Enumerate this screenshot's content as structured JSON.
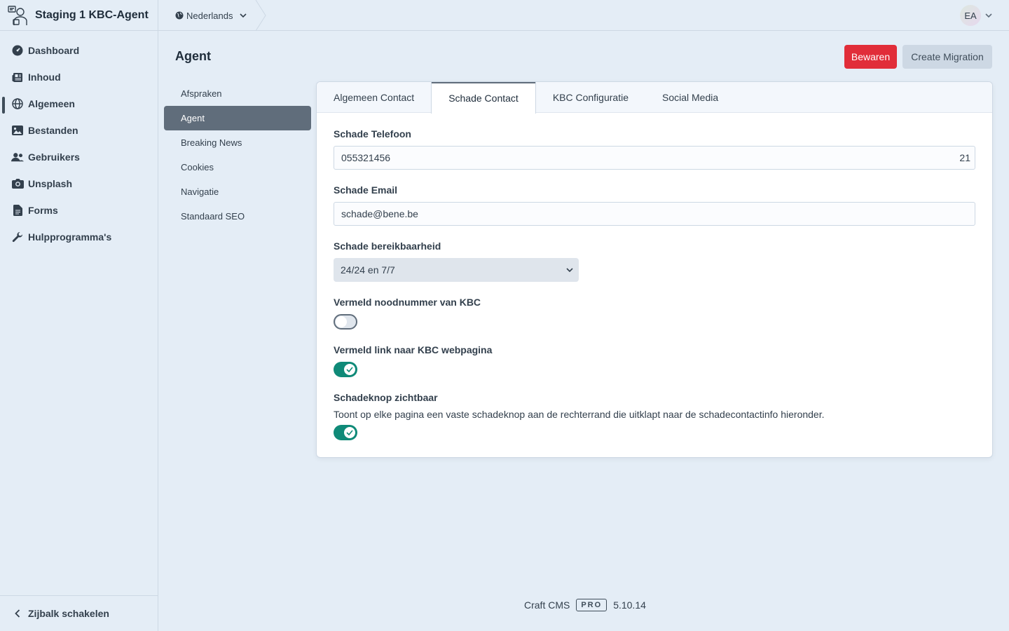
{
  "site": {
    "name": "Staging 1 KBC-Agent"
  },
  "nav": [
    {
      "label": "Dashboard",
      "icon": "gauge-icon"
    },
    {
      "label": "Inhoud",
      "icon": "newspaper-icon"
    },
    {
      "label": "Algemeen",
      "icon": "globe-icon",
      "active": true
    },
    {
      "label": "Bestanden",
      "icon": "image-icon"
    },
    {
      "label": "Gebruikers",
      "icon": "users-icon"
    },
    {
      "label": "Unsplash",
      "icon": "camera-icon"
    },
    {
      "label": "Forms",
      "icon": "file-icon"
    },
    {
      "label": "Hulpprogramma's",
      "icon": "wrench-icon"
    }
  ],
  "sidebar_toggle": "Zijbalk schakelen",
  "topbar": {
    "language": "Nederlands",
    "avatar_initials": "EA"
  },
  "page": {
    "title": "Agent",
    "save_label": "Bewaren",
    "migration_label": "Create Migration"
  },
  "subnav": [
    {
      "label": "Afspraken"
    },
    {
      "label": "Agent",
      "active": true
    },
    {
      "label": "Breaking News"
    },
    {
      "label": "Cookies"
    },
    {
      "label": "Navigatie"
    },
    {
      "label": "Standaard SEO"
    }
  ],
  "tabs": [
    {
      "label": "Algemeen Contact"
    },
    {
      "label": "Schade Contact",
      "active": true
    },
    {
      "label": "KBC Configuratie"
    },
    {
      "label": "Social Media"
    }
  ],
  "fields": {
    "phone": {
      "label": "Schade Telefoon",
      "value": "055321456",
      "remaining": "21"
    },
    "email": {
      "label": "Schade Email",
      "value": "schade@bene.be"
    },
    "reach": {
      "label": "Schade bereikbaarheid",
      "value": "24/24 en 7/7"
    },
    "emergency": {
      "label": "Vermeld noodnummer van KBC",
      "on": false
    },
    "link": {
      "label": "Vermeld link naar KBC webpagina",
      "on": true
    },
    "button": {
      "label": "Schadeknop zichtbaar",
      "instructions": "Toont op elke pagina een vaste schadeknop aan de rechterrand die uitklapt naar de schadecontactinfo hieronder.",
      "on": true
    }
  },
  "footer": {
    "product": "Craft CMS",
    "edition": "PRO",
    "version": "5.10.14"
  },
  "colors": {
    "accent": "#e12d39",
    "toggle_on": "#0f8a78",
    "sidebar_bg": "#e4edf6"
  }
}
